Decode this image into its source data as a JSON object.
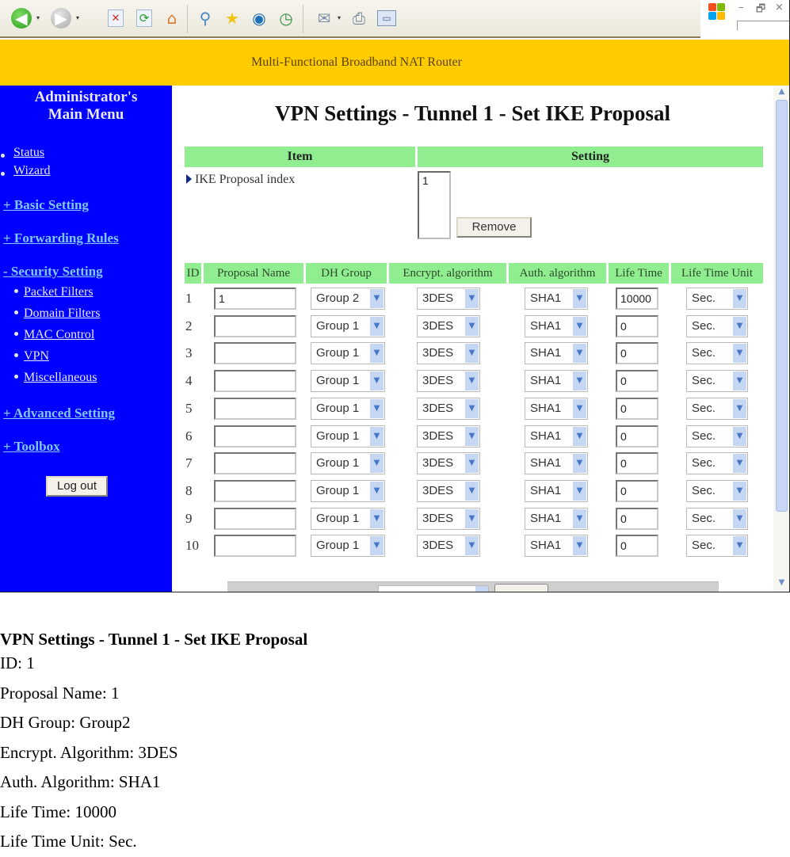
{
  "browser": {
    "toolbar_icons": [
      "back-icon",
      "forward-icon",
      "stop-icon",
      "refresh-icon",
      "home-icon",
      "search-icon",
      "favorites-icon",
      "media-icon",
      "history-icon",
      "mail-icon",
      "print-icon",
      "edit-icon"
    ],
    "window_controls": {
      "minimize": "–",
      "restore": "🗗",
      "close": "×"
    }
  },
  "banner": {
    "text": "Multi-Functional Broadband NAT Router",
    "color": "#ffcc00"
  },
  "sidebar": {
    "title_line1": "Administrator's",
    "title_line2": "Main Menu",
    "bg_color": "#0000ff",
    "links": [
      {
        "label": "Status"
      },
      {
        "label": "Wizard"
      }
    ],
    "sections": [
      {
        "label": "+ Basic Setting"
      },
      {
        "label": "+ Forwarding Rules"
      },
      {
        "label": "- Security Setting"
      }
    ],
    "sub_items": [
      {
        "label": "Packet Filters"
      },
      {
        "label": "Domain Filters"
      },
      {
        "label": "MAC Control"
      },
      {
        "label": "VPN"
      },
      {
        "label": "Miscellaneous"
      }
    ],
    "sections_after": [
      {
        "label": "+ Advanced Setting"
      },
      {
        "label": "+ Toolbox"
      }
    ],
    "logout_label": "Log out"
  },
  "main": {
    "title": "VPN Settings - Tunnel 1 - Set IKE Proposal",
    "header_color": "#90ee90",
    "item_header": "Item",
    "setting_header": "Setting",
    "ike_index_label": "IKE Proposal index",
    "ike_index_values": [
      "1"
    ],
    "remove_label": "Remove",
    "columns": [
      "ID",
      "Proposal Name",
      "DH Group",
      "Encrypt. algorithm",
      "Auth. algorithm",
      "Life Time",
      "Life Time Unit"
    ],
    "rows": [
      {
        "id": "1",
        "name": "1",
        "dh": "Group 2",
        "enc": "3DES",
        "auth": "SHA1",
        "life": "10000",
        "unit": "Sec."
      },
      {
        "id": "2",
        "name": "",
        "dh": "Group 1",
        "enc": "3DES",
        "auth": "SHA1",
        "life": "0",
        "unit": "Sec."
      },
      {
        "id": "3",
        "name": "",
        "dh": "Group 1",
        "enc": "3DES",
        "auth": "SHA1",
        "life": "0",
        "unit": "Sec."
      },
      {
        "id": "4",
        "name": "",
        "dh": "Group 1",
        "enc": "3DES",
        "auth": "SHA1",
        "life": "0",
        "unit": "Sec."
      },
      {
        "id": "5",
        "name": "",
        "dh": "Group 1",
        "enc": "3DES",
        "auth": "SHA1",
        "life": "0",
        "unit": "Sec."
      },
      {
        "id": "6",
        "name": "",
        "dh": "Group 1",
        "enc": "3DES",
        "auth": "SHA1",
        "life": "0",
        "unit": "Sec."
      },
      {
        "id": "7",
        "name": "",
        "dh": "Group 1",
        "enc": "3DES",
        "auth": "SHA1",
        "life": "0",
        "unit": "Sec."
      },
      {
        "id": "8",
        "name": "",
        "dh": "Group 1",
        "enc": "3DES",
        "auth": "SHA1",
        "life": "0",
        "unit": "Sec."
      },
      {
        "id": "9",
        "name": "",
        "dh": "Group 1",
        "enc": "3DES",
        "auth": "SHA1",
        "life": "0",
        "unit": "Sec."
      },
      {
        "id": "10",
        "name": "",
        "dh": "Group 1",
        "enc": "3DES",
        "auth": "SHA1",
        "life": "0",
        "unit": "Sec."
      }
    ]
  },
  "caption": {
    "title": "VPN Settings - Tunnel 1 - Set IKE Proposal",
    "lines": [
      "ID: 1",
      "Proposal Name: 1",
      "DH Group: Group2",
      "Encrypt. Algorithm: 3DES",
      "Auth. Algorithm: SHA1",
      "Life Time: 10000",
      "Life Time Unit: Sec."
    ]
  }
}
